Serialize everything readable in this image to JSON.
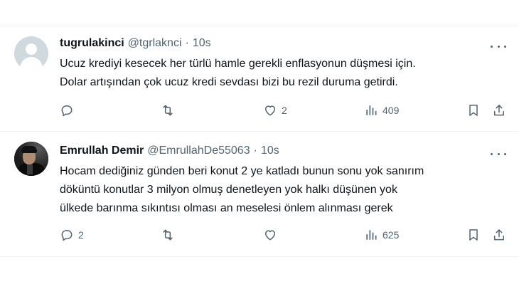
{
  "tweets": [
    {
      "name": "tugrulakinci",
      "handle": "@tgrlaknci",
      "separator": "·",
      "time": "10s",
      "avatar": "default-avatar",
      "text": "Ucuz krediyi kesecek her türlü hamle gerekli enflasyonun düşmesi için.\nDolar artışından çok ucuz kredi sevdası bizi bu rezil duruma getirdi.",
      "replies": "",
      "retweets": "",
      "likes": "2",
      "views": "409"
    },
    {
      "name": "Emrullah Demir",
      "handle": "@EmrullahDe55063",
      "separator": "·",
      "time": "10s",
      "avatar": "profile-photo",
      "text": "Hocam dediğiniz günden beri konut 2 ye katladı bunun sonu yok sanırım\ndöküntü konutlar 3 milyon  olmuş denetleyen yok halkı düşünen yok\nülkede barınma sıkıntısı olması an meselesi önlem alınması gerek",
      "replies": "2",
      "retweets": "",
      "likes": "",
      "views": "625"
    }
  ],
  "icons": {
    "reply": "reply-icon",
    "retweet": "retweet-icon",
    "like": "heart-icon",
    "views": "views-icon",
    "bookmark": "bookmark-icon",
    "share": "share-icon",
    "more": "more-icon"
  },
  "colors": {
    "text": "#0f1419",
    "secondary": "#536471",
    "divider": "#eff3f4"
  }
}
